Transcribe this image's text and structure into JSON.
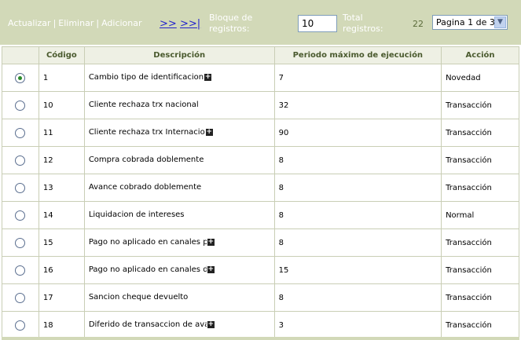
{
  "toolbar": {
    "actualizar": "Actualizar",
    "eliminar": "Eliminar",
    "adicionar": "Adicionar",
    "separator": "|",
    "nav_next": ">>",
    "nav_last": ">>|",
    "bloque_label": "Bloque de registros:",
    "bloque_value": "10",
    "total_label": "Total registros:",
    "total_value": "22",
    "page_selected": "Pagina 1 de 3"
  },
  "table": {
    "columns": [
      "",
      "Código",
      "Descripción",
      "Periodo máximo de ejecución",
      "Acción"
    ],
    "rows": [
      {
        "selected": true,
        "codigo": "1",
        "descripcion": "Cambio tipo de identificacion",
        "truncated": true,
        "periodo": "7",
        "accion": "Novedad"
      },
      {
        "selected": false,
        "codigo": "10",
        "descripcion": "Cliente rechaza trx nacional",
        "truncated": false,
        "periodo": "32",
        "accion": "Transacción"
      },
      {
        "selected": false,
        "codigo": "11",
        "descripcion": "Cliente rechaza trx Internacio",
        "truncated": true,
        "periodo": "90",
        "accion": "Transacción"
      },
      {
        "selected": false,
        "codigo": "12",
        "descripcion": "Compra cobrada doblemente",
        "truncated": false,
        "periodo": "8",
        "accion": "Transacción"
      },
      {
        "selected": false,
        "codigo": "13",
        "descripcion": "Avance cobrado doblemente",
        "truncated": false,
        "periodo": "8",
        "accion": "Transacción"
      },
      {
        "selected": false,
        "codigo": "14",
        "descripcion": "Liquidacion de intereses",
        "truncated": false,
        "periodo": "8",
        "accion": "Normal"
      },
      {
        "selected": false,
        "codigo": "15",
        "descripcion": "Pago no aplicado en canales pr",
        "truncated": true,
        "periodo": "8",
        "accion": "Transacción"
      },
      {
        "selected": false,
        "codigo": "16",
        "descripcion": "Pago no aplicado en canales de",
        "truncated": true,
        "periodo": "15",
        "accion": "Transacción"
      },
      {
        "selected": false,
        "codigo": "17",
        "descripcion": "Sancion cheque devuelto",
        "truncated": false,
        "periodo": "8",
        "accion": "Transacción"
      },
      {
        "selected": false,
        "codigo": "18",
        "descripcion": "Diferido de transaccion de ava",
        "truncated": true,
        "periodo": "3",
        "accion": "Transacción"
      }
    ]
  },
  "icons": {
    "expand": "plus-icon",
    "dropdown": "chevron-down-icon"
  },
  "colors": {
    "toolbar_bg": "#d2d9b8",
    "header_text": "#4a5a2e",
    "grid_border": "#c9ceb5",
    "radio_checked": "#2b8a2b",
    "nav_link": "#2222cc"
  }
}
